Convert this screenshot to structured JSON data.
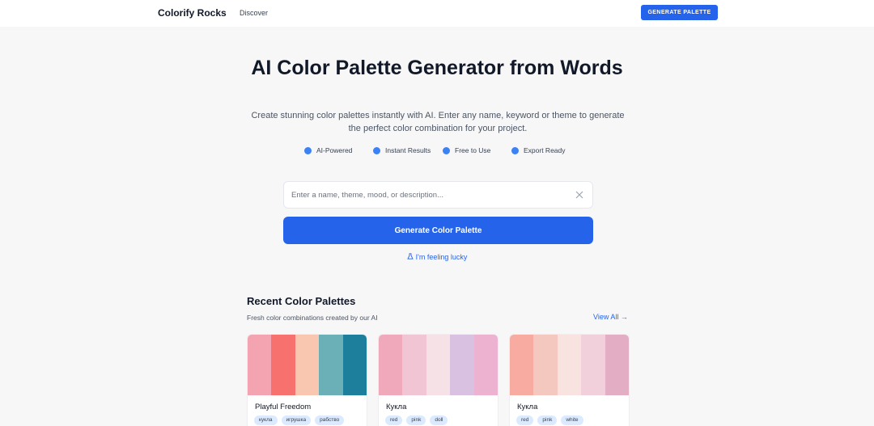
{
  "header": {
    "brand": "Colorify Rocks",
    "nav": [
      "Discover"
    ],
    "cta_label": "GENERATE PALETTE"
  },
  "hero": {
    "title": "AI Color Palette Generator from Words",
    "subtitle": "Create stunning color palettes instantly with AI. Enter any name, keyword or theme to generate the perfect color combination for your project.",
    "features": [
      "AI-Powered",
      "Instant Results",
      "Free to Use",
      "Export Ready"
    ]
  },
  "search": {
    "value": "",
    "placeholder": "Enter a name, theme, mood, or description...",
    "clear_icon": "close-icon"
  },
  "generate_button": "Generate Color Palette",
  "lucky_link": "I'm feeling lucky",
  "recent": {
    "title": "Recent Color Palettes",
    "subtitle": "Fresh color combinations created by our AI",
    "view_all": "View All →",
    "palettes": [
      {
        "name": "Playful Freedom",
        "colors": [
          "#f4a3b1",
          "#f7716f",
          "#f9c6b0",
          "#6ab0b6",
          "#1d7f9c"
        ],
        "tags": [
          "кукла",
          "игрушка",
          "рабство"
        ]
      },
      {
        "name": "Кукла",
        "colors": [
          "#f0a9bb",
          "#f2c5d4",
          "#f5e1e6",
          "#d9c1e2",
          "#ecb2cf"
        ],
        "tags": [
          "red",
          "pink",
          "doll"
        ]
      },
      {
        "name": "Кукла",
        "colors": [
          "#f7aba1",
          "#f4c8bf",
          "#f8e3e0",
          "#f1d0db",
          "#e3aec4"
        ],
        "tags": [
          "red",
          "pink",
          "white"
        ]
      }
    ]
  },
  "colors": {
    "accent": "#2563eb",
    "feature_dot": "#3b82f6",
    "tag_bg": "#dbeafe",
    "page_bg": "#f7f7f8"
  }
}
